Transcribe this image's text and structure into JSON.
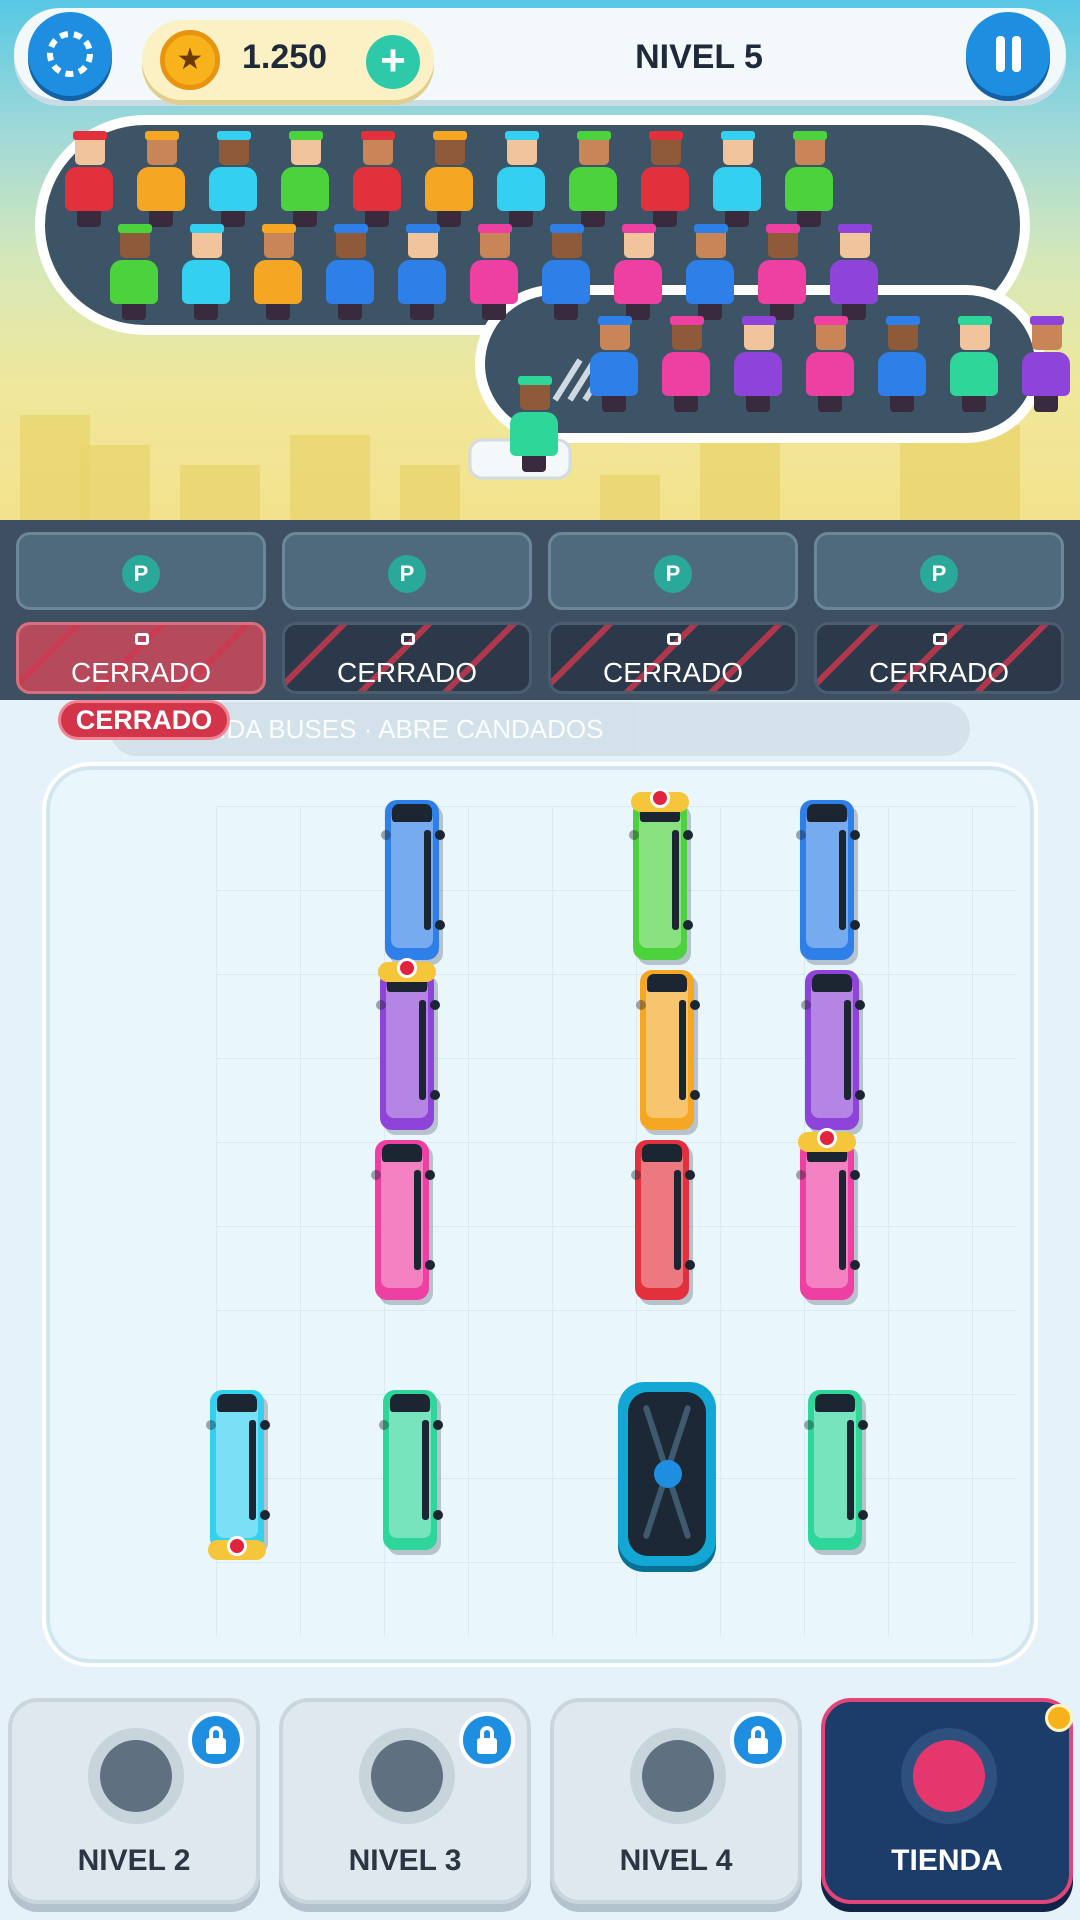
{
  "header": {
    "coins": "1.250",
    "level_title": "NIVEL 5"
  },
  "colors": {
    "primary_blue": "#1e8fe0",
    "accent_teal": "#2ec9a8",
    "locked_red": "#d2344a",
    "shop_navy": "#1c3d6a",
    "shop_pink": "#e24679"
  },
  "icons": {
    "restart": "restart-icon",
    "coin": "coin-icon",
    "add_coins": "plus-icon",
    "pause": "pause-icon",
    "parking": "parking-icon",
    "lock": "lock-icon",
    "shop": "shopping-bag-icon"
  },
  "queue": {
    "passenger_colors": [
      "red",
      "orange",
      "cyan",
      "green",
      "red",
      "orange",
      "cyan",
      "green",
      "red",
      "cyan",
      "green",
      "green",
      "cyan",
      "orange",
      "blue",
      "blue",
      "pink",
      "blue",
      "pink",
      "blue",
      "pink",
      "purple",
      "blue",
      "pink",
      "purple",
      "pink",
      "blue",
      "mint",
      "purple",
      "mint"
    ],
    "palette": {
      "red": "#e2303d",
      "orange": "#f5a623",
      "cyan": "#33d0f0",
      "green": "#4cd23d",
      "blue": "#2f7fe8",
      "pink": "#ee3fa3",
      "purple": "#8e44d8",
      "mint": "#2ed69a"
    }
  },
  "parking": {
    "slot_badge": "P",
    "locked_label": "CERRADO",
    "locked_tag": "CERRADO",
    "hint_line": "SALIDA BUSES · ABRE CANDADOS",
    "slots": [
      "P",
      "P",
      "P",
      "P"
    ]
  },
  "board": {
    "buses": [
      {
        "color": "blue"
      },
      {
        "color": "green",
        "locked": true
      },
      {
        "color": "blue"
      },
      {
        "color": "purple",
        "locked": true
      },
      {
        "color": "orange"
      },
      {
        "color": "purple"
      },
      {
        "color": "pink"
      },
      {
        "color": "red"
      },
      {
        "color": "pink",
        "locked": true
      },
      {
        "color": "cyan",
        "locked": true
      },
      {
        "color": "mint"
      },
      {
        "color": "mint"
      }
    ]
  },
  "bottom_nav": {
    "tabs": [
      {
        "label": "NIVEL 2",
        "locked": true
      },
      {
        "label": "NIVEL 3",
        "locked": true
      },
      {
        "label": "NIVEL 4",
        "locked": true
      },
      {
        "label": "TIENDA",
        "locked": false
      }
    ]
  }
}
